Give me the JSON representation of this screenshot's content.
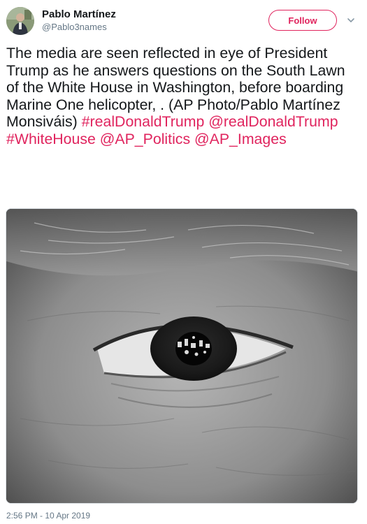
{
  "author": {
    "name": "Pablo Martínez",
    "handle": "@Pablo3names",
    "avatar_icon": "profile-photo"
  },
  "actions": {
    "follow_label": "Follow",
    "follow_color": "#e0245e",
    "menu_icon": "chevron-down-icon"
  },
  "tweet": {
    "segments": [
      {
        "type": "text",
        "value": "The media are seen reflected in eye of President Trump as he answers questions on the South Lawn of the White House in Washington, before boarding Marine One helicopter, . (AP Photo/Pablo Martínez Monsiváis) "
      },
      {
        "type": "link",
        "value": "#realDonaldTrump"
      },
      {
        "type": "text",
        "value": " "
      },
      {
        "type": "link",
        "value": "@realDonaldTrump"
      },
      {
        "type": "text",
        "value": "  "
      },
      {
        "type": "link",
        "value": "#WhiteHouse"
      },
      {
        "type": "text",
        "value": " "
      },
      {
        "type": "link",
        "value": "@AP_Politics"
      },
      {
        "type": "text",
        "value": " "
      },
      {
        "type": "link",
        "value": "@AP_Images"
      }
    ],
    "link_color": "#e0245e"
  },
  "media": {
    "subject": "black-and-white close-up of an eye reflecting media"
  },
  "meta": {
    "timestamp": "2:56 PM - 10 Apr 2019"
  }
}
